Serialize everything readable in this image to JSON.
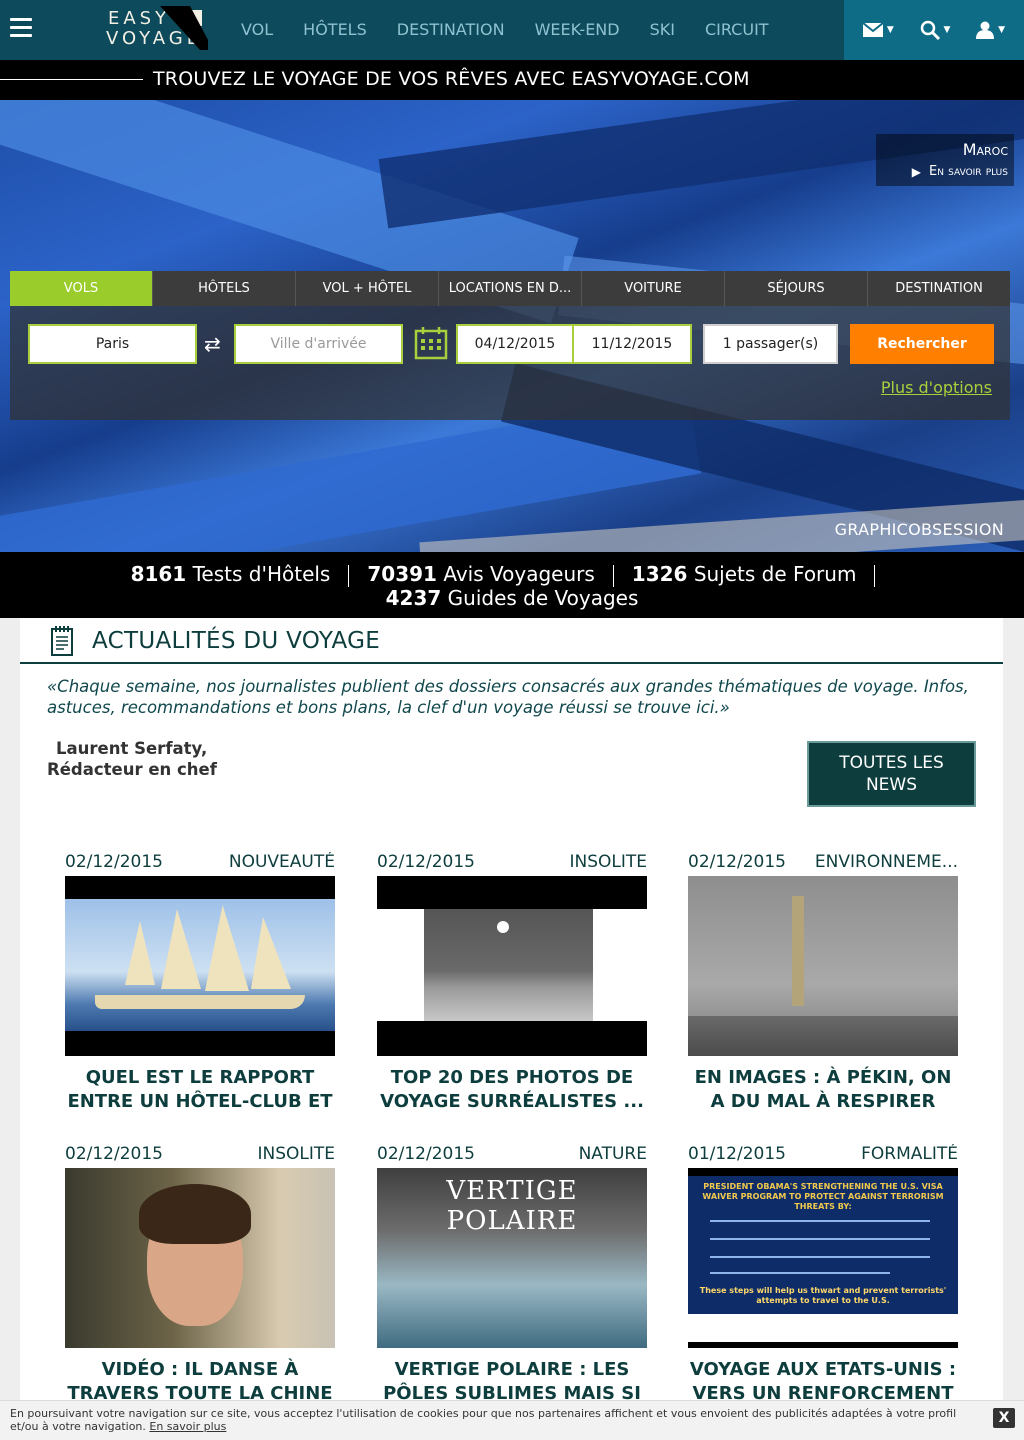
{
  "brand": {
    "line1": "EASY",
    "line2": "VOYAGE"
  },
  "nav": {
    "menu": [
      "VOL",
      "HÔTELS",
      "DESTINATION",
      "WEEK-END",
      "SKI",
      "CIRCUIT"
    ],
    "icons": [
      "envelope-icon",
      "search-icon",
      "user-icon"
    ]
  },
  "tagline": "TROUVEZ LE VOYAGE DE VOS RÊVES AVEC EASYVOYAGE.COM",
  "hero": {
    "promo_place": "Maroc",
    "promo_link": "En savoir plus",
    "credit": "GRAPHICOBSESSION"
  },
  "search": {
    "tabs": [
      "VOLS",
      "HÔTELS",
      "VOL + HÔTEL",
      "LOCATIONS EN D...",
      "VOITURE",
      "SÉJOURS",
      "DESTINATION"
    ],
    "active_tab": "VOLS",
    "departure": "Paris",
    "arrival_placeholder": "Ville d'arrivée",
    "date_out": "04/12/2015",
    "date_back": "11/12/2015",
    "passengers": "1 passager(s)",
    "button": "Rechercher",
    "more_options": "Plus d'options"
  },
  "stats": [
    {
      "num": "8161",
      "label": "Tests d'Hôtels"
    },
    {
      "num": "70391",
      "label": "Avis Voyageurs"
    },
    {
      "num": "1326",
      "label": "Sujets de Forum"
    },
    {
      "num": "4237",
      "label": "Guides de Voyages"
    }
  ],
  "news": {
    "title": "ACTUALITÉS DU VOYAGE",
    "intro": "«Chaque semaine, nos journalistes publient des dossiers consacrés aux grandes thématiques de voyage. Infos, astuces, recommandations et bons plans, la clef d'un voyage réussi se trouve ici.»",
    "author_name": "Laurent Serfaty,",
    "author_role": "Rédacteur en chef",
    "all_button_l1": "TOUTES LES",
    "all_button_l2": "NEWS",
    "cards": [
      {
        "date": "02/12/2015",
        "category": "NOUVEAUTÉ",
        "title": "QUEL EST LE RAPPORT ENTRE UN HÔTEL-CLUB ET",
        "image": "sailing-ship"
      },
      {
        "date": "02/12/2015",
        "category": "INSOLITE",
        "title": "TOP 20 DES PHOTOS DE VOYAGE SURRÉALISTES ...",
        "image": "moon-photo"
      },
      {
        "date": "02/12/2015",
        "category": "ENVIRONNEME...",
        "title": "EN IMAGES : À PÉKIN, ON A DU MAL À RESPIRER",
        "image": "beijing-smog"
      },
      {
        "date": "02/12/2015",
        "category": "INSOLITE",
        "title": "VIDÉO : IL DANSE À TRAVERS TOUTE LA CHINE",
        "image": "face-closeup"
      },
      {
        "date": "02/12/2015",
        "category": "NATURE",
        "title": "VERTIGE POLAIRE : LES PÔLES SUBLIMES MAIS SI",
        "image": "polar-glacier"
      },
      {
        "date": "01/12/2015",
        "category": "FORMALITÉ",
        "title": "VOYAGE AUX ETATS-UNIS : VERS UN RENFORCEMENT",
        "image": "visa-infographic"
      }
    ],
    "polar_title": "VERTIGE POLAIRE",
    "visa_head": "PRESIDENT OBAMA'S STRENGTHENING THE U.S. VISA WAIVER PROGRAM TO PROTECT AGAINST TERRORISM THREATS BY:",
    "visa_foot": "These steps will help us thwart and prevent terrorists' attempts to travel to the U.S."
  },
  "cookie": {
    "message": "En poursuivant votre navigation sur ce site, vous acceptez l'utilisation de cookies pour que nos partenaires affichent et vous envoient des publicités adaptées à votre profil et/ou à votre navigation.",
    "link": "En savoir plus",
    "close": "X"
  },
  "colors": {
    "nav_bg": "#0d4a5c",
    "nav_right_bg": "#0e6c86",
    "accent_green": "#9acc2c",
    "search_orange": "#ff7f00",
    "news_dark": "#0e3d3d"
  }
}
